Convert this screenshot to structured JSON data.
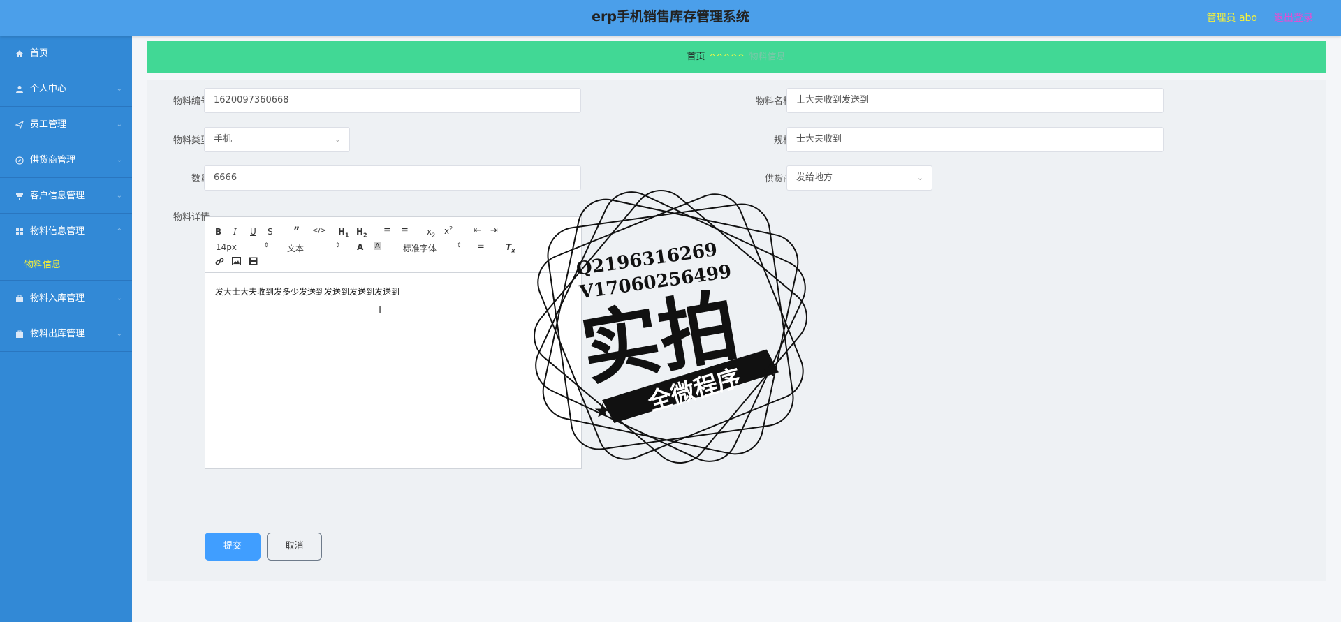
{
  "header": {
    "title": "erp手机销售库存管理系统",
    "user": "管理员 abo",
    "logout": "退出登录"
  },
  "sidebar": {
    "items": [
      {
        "label": "首页",
        "icon": "home-icon",
        "expandable": false
      },
      {
        "label": "个人中心",
        "icon": "user-icon",
        "expandable": true
      },
      {
        "label": "员工管理",
        "icon": "send-icon",
        "expandable": true
      },
      {
        "label": "供货商管理",
        "icon": "compass-icon",
        "expandable": true
      },
      {
        "label": "客户信息管理",
        "icon": "filter-icon",
        "expandable": true
      },
      {
        "label": "物料信息管理",
        "icon": "grid-icon",
        "expandable": true,
        "expanded": true
      },
      {
        "label": "物料入库管理",
        "icon": "box-icon",
        "expandable": true
      },
      {
        "label": "物料出库管理",
        "icon": "box-icon",
        "expandable": true
      }
    ],
    "sub_item": "物料信息"
  },
  "breadcrumb": {
    "home": "首页",
    "separator": "^^^^^",
    "current": "物料信息"
  },
  "form": {
    "code_label": "物料编号",
    "code_value": "1620097360668",
    "name_label": "物料名称",
    "name_value": "士大夫收到发送到",
    "type_label": "物料类型",
    "type_value": "手机",
    "spec_label": "规格",
    "spec_value": "士大夫收到",
    "qty_label": "数量",
    "qty_value": "6666",
    "supplier_label": "供货商",
    "supplier_value": "发给地方",
    "detail_label": "物料详情"
  },
  "editor": {
    "font_size": "14px",
    "text_type": "文本",
    "font_family": "标准字体",
    "content": "发大士大夫收到发多少发送到发送到发送到发送到"
  },
  "buttons": {
    "submit": "提交",
    "cancel": "取消"
  },
  "watermark": {
    "line1": "Q2196316269",
    "line2": "V17060256499",
    "big": "实拍",
    "banner": "全微程序"
  },
  "colors": {
    "header": "#4b9fea",
    "sidebar": "#3289d6",
    "breadcrumb": "#41d895",
    "submit": "#409eff",
    "accent_yellow": "#f4ef3a",
    "logout": "#e94bd2"
  }
}
